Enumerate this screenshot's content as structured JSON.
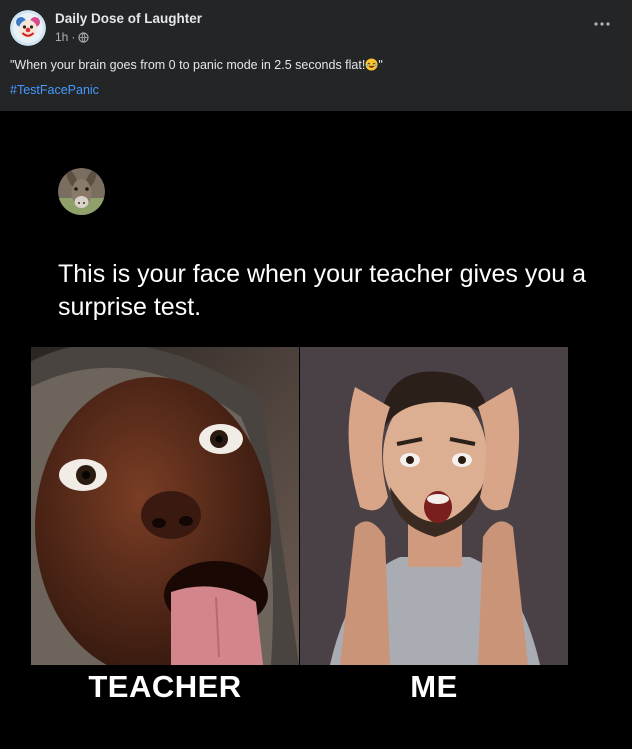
{
  "post": {
    "page_name": "Daily Dose of Laughter",
    "time": "1h",
    "separator": "·",
    "privacy_icon": "globe-icon",
    "more_icon": "more-horizontal-icon",
    "caption": "\"When your brain goes from 0 to panic mode in 2.5 seconds flat!",
    "caption_emoji": "rolling-on-floor-laughing-emoji",
    "caption_end": "\"",
    "hashtag": "#TestFacePanic"
  },
  "meme": {
    "text": "This is your face when your teacher gives you a surprise test.",
    "left_label": "TEACHER",
    "right_label": "ME",
    "avatar_icon": "donkey-avatar",
    "left_photo": "child-tongue-out-photo",
    "right_photo": "shocked-man-photo"
  },
  "colors": {
    "card_background": "#242526",
    "image_background": "#000000",
    "primary_text": "#e4e6eb",
    "secondary_text": "#b0b3b8",
    "hashtag": "#4599ff",
    "meme_text": "#ffffff"
  }
}
